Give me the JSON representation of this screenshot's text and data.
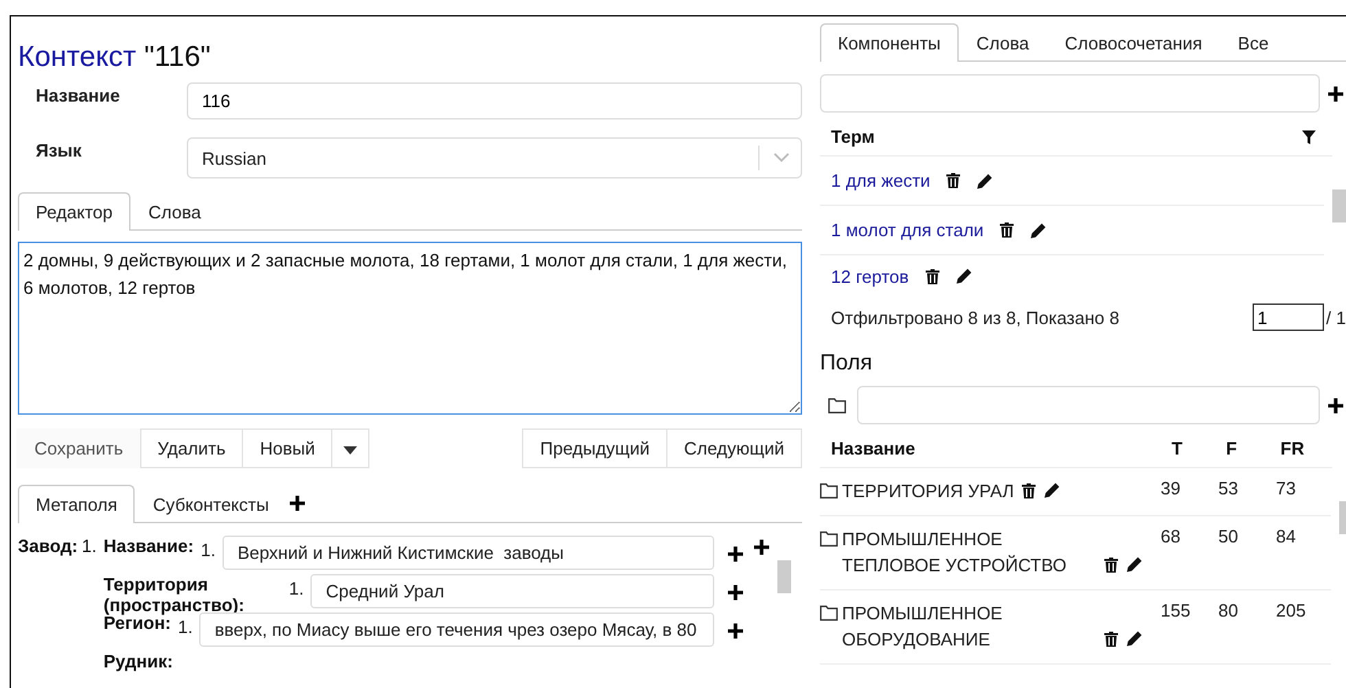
{
  "title": {
    "label": "Контекст",
    "name": "\"116\""
  },
  "form": [
    {
      "label": "Название",
      "value": "116",
      "kind": "input"
    },
    {
      "label": "Язык",
      "value": "Russian",
      "kind": "select"
    }
  ],
  "editor_tabs": [
    {
      "label": "Редактор",
      "selected": true
    },
    {
      "label": "Слова",
      "selected": false
    }
  ],
  "editor_text": "2 домны, 9 действующих и 2 запасные молота, 18 гертами, 1 молот для стали, 1 для жести, 6 молотов, 12 гертов",
  "buttons_left": [
    {
      "label": "Сохранить",
      "disabled": true
    },
    {
      "label": "Удалить",
      "disabled": false
    },
    {
      "label": "Новый",
      "disabled": false
    }
  ],
  "buttons_right": [
    "Предыдущий",
    "Следующий"
  ],
  "meta_tabs": [
    {
      "label": "Метаполя",
      "selected": true
    },
    {
      "label": "Субконтексты",
      "selected": false
    }
  ],
  "metafields": {
    "group": "Завод:",
    "group_index": "1.",
    "fields": [
      {
        "label": "Название:",
        "index": "1.",
        "value": "Верхний и Нижний Кистимские  заводы"
      },
      {
        "label": "Территория (пространство):",
        "index": "1.",
        "value": "Средний Урал"
      },
      {
        "label": "Регион:",
        "index": "1.",
        "value": "вверх, по Миасу выше его течения чрез озеро Мясау, в 80"
      },
      {
        "label": "Рудник:"
      }
    ]
  },
  "term_tabs": [
    {
      "label": "Компоненты",
      "selected": true
    },
    {
      "label": "Слова",
      "selected": false
    },
    {
      "label": "Словосочетания",
      "selected": false
    },
    {
      "label": "Все",
      "selected": false
    }
  ],
  "term_table": {
    "column": "Терм",
    "rows": [
      "1 для жести",
      "1 молот для стали",
      "12 гертов"
    ]
  },
  "filter_status": "Отфильтровано 8 из 8, Показано 8",
  "page_input": "1",
  "page_total": "/ 1",
  "fields_panel": {
    "title": "Поля",
    "columns": [
      "Название",
      "T",
      "F",
      "FR"
    ],
    "rows": [
      {
        "name": "ТЕРРИТОРИЯ УРАЛ",
        "t": "39",
        "f": "53",
        "fr": "73"
      },
      {
        "name": "ПРОМЫШЛЕННОЕ ТЕПЛОВОЕ УСТРОЙСТВО",
        "t": "68",
        "f": "50",
        "fr": "84"
      },
      {
        "name": "ПРОМЫШЛЕННОЕ ОБОРУДОВАНИЕ",
        "t": "155",
        "f": "80",
        "fr": "205"
      }
    ]
  }
}
